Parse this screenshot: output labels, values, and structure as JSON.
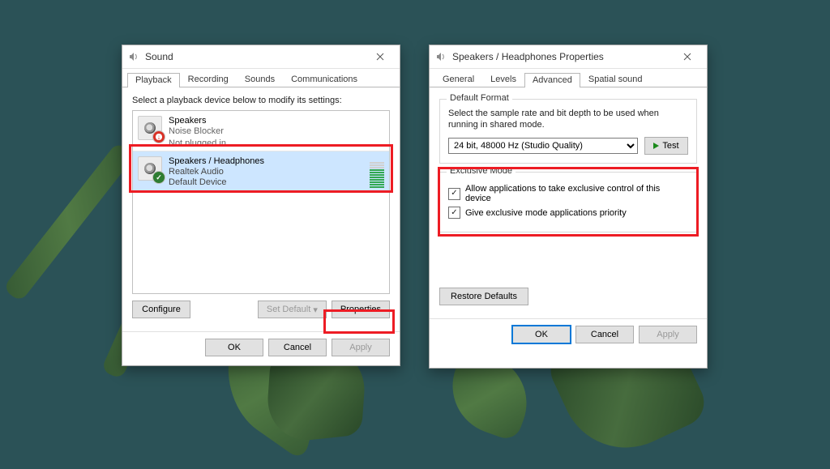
{
  "sound_window": {
    "title": "Sound",
    "tabs": {
      "playback": "Playback",
      "recording": "Recording",
      "sounds": "Sounds",
      "communications": "Communications"
    },
    "instruction": "Select a playback device below to modify its settings:",
    "devices": [
      {
        "name": "Speakers",
        "line2": "Noise Blocker",
        "status": "Not plugged in",
        "badge": "error"
      },
      {
        "name": "Speakers / Headphones",
        "line2": "Realtek Audio",
        "status": "Default Device",
        "badge": "default",
        "selected": true
      }
    ],
    "buttons": {
      "configure": "Configure",
      "set_default": "Set Default",
      "properties": "Properties",
      "ok": "OK",
      "cancel": "Cancel",
      "apply": "Apply"
    }
  },
  "props_window": {
    "title": "Speakers / Headphones Properties",
    "tabs": {
      "general": "General",
      "levels": "Levels",
      "advanced": "Advanced",
      "spatial": "Spatial sound"
    },
    "default_format": {
      "legend": "Default Format",
      "desc": "Select the sample rate and bit depth to be used when running in shared mode.",
      "selected": "24 bit, 48000 Hz (Studio Quality)",
      "test": "Test"
    },
    "exclusive_mode": {
      "legend": "Exclusive Mode",
      "opt1": "Allow applications to take exclusive control of this device",
      "opt2": "Give exclusive mode applications priority"
    },
    "buttons": {
      "restore": "Restore Defaults",
      "ok": "OK",
      "cancel": "Cancel",
      "apply": "Apply"
    }
  }
}
